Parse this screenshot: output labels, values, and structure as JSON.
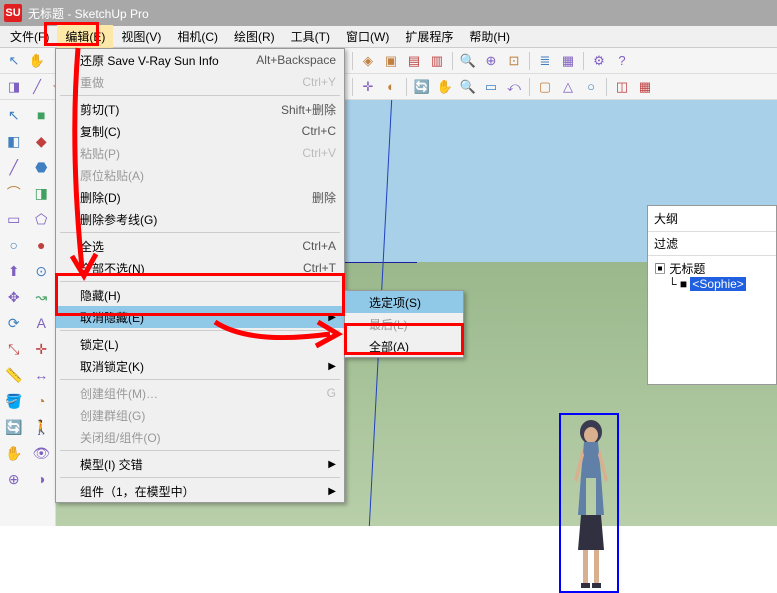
{
  "title": "无标题 - SketchUp Pro",
  "app_icon_text": "SU",
  "menubar": [
    "文件(F)",
    "编辑(E)",
    "视图(V)",
    "相机(C)",
    "绘图(R)",
    "工具(T)",
    "窗口(W)",
    "扩展程序",
    "帮助(H)"
  ],
  "dropdown": {
    "items": [
      {
        "label": "还原 Save V-Ray Sun Info",
        "shortcut": "Alt+Backspace",
        "disabled": false
      },
      {
        "label": "重做",
        "shortcut": "Ctrl+Y",
        "disabled": true
      },
      {
        "sep": true
      },
      {
        "label": "剪切(T)",
        "shortcut": "Shift+删除",
        "disabled": false
      },
      {
        "label": "复制(C)",
        "shortcut": "Ctrl+C",
        "disabled": false
      },
      {
        "label": "粘贴(P)",
        "shortcut": "Ctrl+V",
        "disabled": true
      },
      {
        "label": "原位粘贴(A)",
        "shortcut": "",
        "disabled": true
      },
      {
        "label": "删除(D)",
        "shortcut": "删除",
        "disabled": false
      },
      {
        "label": "删除参考线(G)",
        "shortcut": "",
        "disabled": false
      },
      {
        "sep": true
      },
      {
        "label": "全选",
        "shortcut": "Ctrl+A",
        "disabled": false
      },
      {
        "label": "全部不选(N)",
        "shortcut": "Ctrl+T",
        "disabled": false
      },
      {
        "sep": true
      },
      {
        "label": "隐藏(H)",
        "shortcut": "",
        "disabled": false
      },
      {
        "label": "取消隐藏(E)",
        "shortcut": "",
        "disabled": false,
        "arrow": true,
        "hl": true
      },
      {
        "sep": true
      },
      {
        "label": "锁定(L)",
        "shortcut": "",
        "disabled": false
      },
      {
        "label": "取消锁定(K)",
        "shortcut": "",
        "disabled": false,
        "arrow": true
      },
      {
        "sep": true
      },
      {
        "label": "创建组件(M)…",
        "shortcut": "G",
        "disabled": true
      },
      {
        "label": "创建群组(G)",
        "shortcut": "",
        "disabled": true
      },
      {
        "label": "关闭组/组件(O)",
        "shortcut": "",
        "disabled": true
      },
      {
        "sep": true
      },
      {
        "label": "模型(I) 交错",
        "shortcut": "",
        "disabled": false,
        "arrow": true
      },
      {
        "sep": true
      },
      {
        "label": "组件（1，在模型中）",
        "shortcut": "",
        "disabled": false,
        "arrow": true
      }
    ]
  },
  "submenu": {
    "items": [
      {
        "label": "选定项(S)",
        "hl": true
      },
      {
        "label": "最后(L)",
        "disabled": true
      },
      {
        "label": "全部(A)"
      }
    ]
  },
  "outliner": {
    "title": "大纲",
    "filter_label": "过滤",
    "root": "无标题",
    "selected": "<Sophie>"
  },
  "toolbar_top_icons": [
    "cursor",
    "hand",
    "undo",
    "redo",
    "sep",
    "cut",
    "copy",
    "paste",
    "sep",
    "spray",
    "eraser",
    "sep",
    "cube",
    "house",
    "house2",
    "house3",
    "cube2",
    "sep",
    "iso",
    "top",
    "front",
    "right",
    "sep",
    "search",
    "zoom",
    "zoom-ext",
    "sep",
    "layers",
    "materials",
    "sep",
    "gear",
    "help"
  ],
  "toolbar_second_icons": [
    "comp",
    "line",
    "line2",
    "rect",
    "sep",
    "move",
    "rot",
    "scale",
    "sep",
    "push",
    "follow",
    "offset",
    "sep",
    "tape",
    "protr",
    "text",
    "dim",
    "sep",
    "axes",
    "sec",
    "sep",
    "orbit",
    "pan",
    "zoom2",
    "window",
    "prev",
    "sep",
    "box",
    "cone",
    "sphere",
    "sep",
    "faces",
    "edges"
  ],
  "side_left": [
    "cursor",
    "eraser",
    "line",
    "arc",
    "rect",
    "circle",
    "push",
    "move",
    "rotate",
    "scale",
    "tape",
    "paint",
    "orbit",
    "pan",
    "zoom"
  ],
  "side_right": [
    "sq",
    "shape",
    "shape2",
    "eraser2",
    "poly",
    "circ2",
    "offset",
    "follow2",
    "text",
    "axis2",
    "dim2",
    "protract",
    "walk",
    "look",
    "sect"
  ],
  "colors": {
    "red": "#ff0000",
    "highlight": "#90c8e8"
  }
}
